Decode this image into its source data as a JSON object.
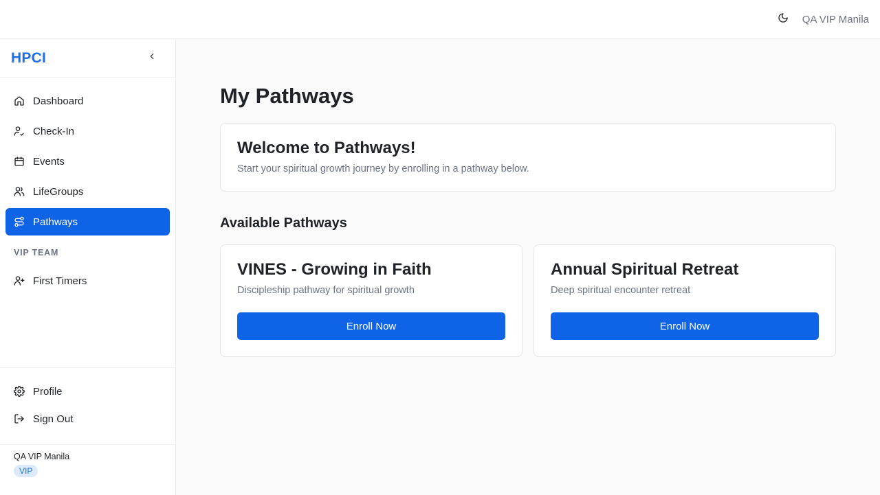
{
  "header": {
    "user_name": "QA VIP Manila",
    "theme_icon": "moon-icon"
  },
  "sidebar": {
    "brand": "HPCI",
    "items": [
      {
        "label": "Dashboard",
        "icon": "home-icon"
      },
      {
        "label": "Check-In",
        "icon": "user-check-icon"
      },
      {
        "label": "Events",
        "icon": "calendar-icon"
      },
      {
        "label": "LifeGroups",
        "icon": "users-icon"
      },
      {
        "label": "Pathways",
        "icon": "route-icon",
        "active": true
      }
    ],
    "section_label": "VIP TEAM",
    "section_items": [
      {
        "label": "First Timers",
        "icon": "user-plus-icon"
      }
    ],
    "bottom_items": [
      {
        "label": "Profile",
        "icon": "gear-icon"
      },
      {
        "label": "Sign Out",
        "icon": "sign-out-icon"
      }
    ],
    "user": {
      "name": "QA VIP Manila",
      "badge": "VIP"
    }
  },
  "main": {
    "title": "My Pathways",
    "welcome": {
      "title": "Welcome to Pathways!",
      "subtitle": "Start your spiritual growth journey by enrolling in a pathway below."
    },
    "available_title": "Available Pathways",
    "pathways": [
      {
        "title": "VINES - Growing in Faith",
        "description": "Discipleship pathway for spiritual growth",
        "button": "Enroll Now"
      },
      {
        "title": "Annual Spiritual Retreat",
        "description": "Deep spiritual encounter retreat",
        "button": "Enroll Now"
      }
    ]
  },
  "colors": {
    "accent": "#0e63e6",
    "brand": "#1f6fe0",
    "muted": "#6b7280"
  }
}
